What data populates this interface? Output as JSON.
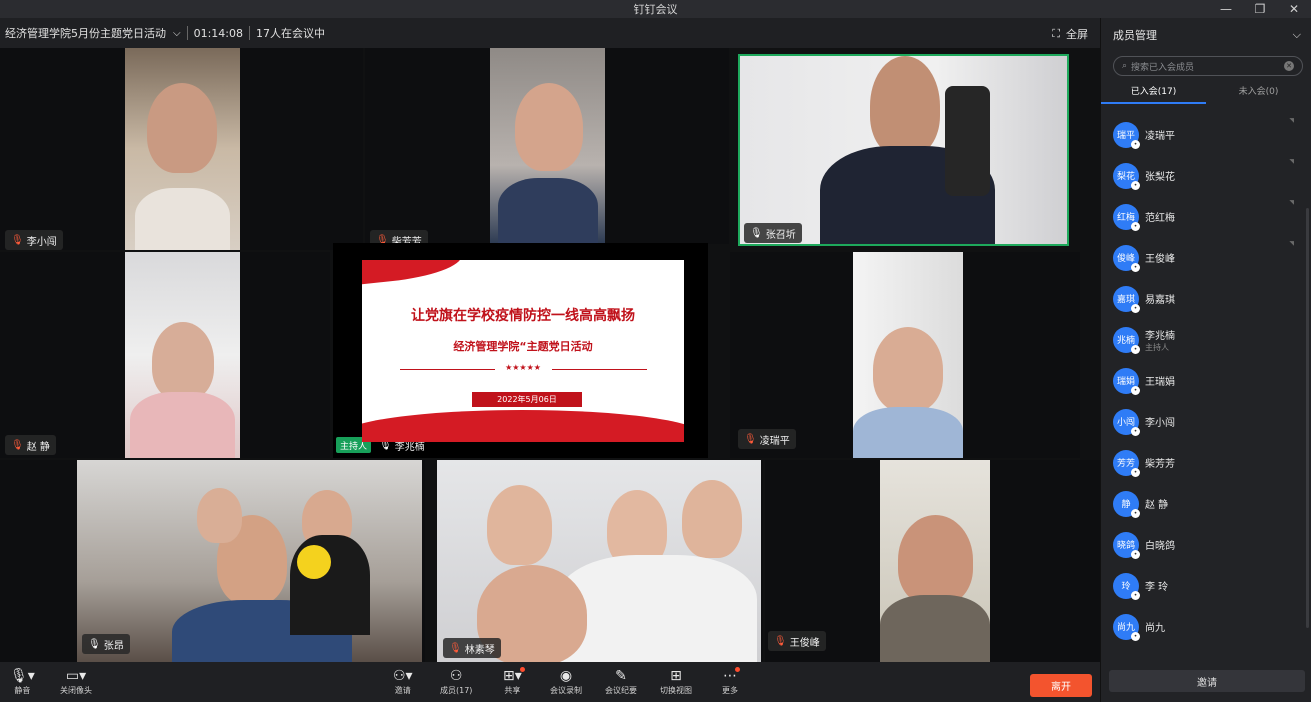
{
  "window": {
    "title": "钉钉会议"
  },
  "infobar": {
    "meeting_name": "经济管理学院5月份主题党日活动",
    "duration": "01:14:08",
    "count_text": "17人在会议中",
    "fullscreen_label": "全屏"
  },
  "tiles": [
    {
      "name": "李小闯"
    },
    {
      "name": "柴芳芳"
    },
    {
      "name": "张召圻"
    },
    {
      "name": "赵 静"
    },
    {
      "name": "李兆楠",
      "badge": "主持人"
    },
    {
      "name": "凌瑞平"
    },
    {
      "name": "张昂"
    },
    {
      "name": "林素琴"
    },
    {
      "name": "王俊峰"
    }
  ],
  "slide": {
    "title": "让党旗在学校疫情防控一线高高飘扬",
    "subtitle": "经济管理学院“主题党日活动",
    "stars": "★★★★★",
    "date": "2022年5月06日"
  },
  "sidebar": {
    "title": "成员管理",
    "search_placeholder": "搜索已入会成员",
    "tab_joined": "已入会(17)",
    "tab_not_joined": "未入会(0)",
    "members": [
      {
        "avatar": "瑞平",
        "name": "凌瑞平"
      },
      {
        "avatar": "梨花",
        "name": "张梨花"
      },
      {
        "avatar": "红梅",
        "name": "范红梅"
      },
      {
        "avatar": "俊峰",
        "name": "王俊峰"
      },
      {
        "avatar": "嘉琪",
        "name": "易嘉琪"
      },
      {
        "avatar": "兆楠",
        "name": "李兆楠",
        "sub": "主持人"
      },
      {
        "avatar": "瑞娟",
        "name": "王瑞娟"
      },
      {
        "avatar": "小闯",
        "name": "李小闯"
      },
      {
        "avatar": "芳芳",
        "name": "柴芳芳"
      },
      {
        "avatar": "静",
        "name": "赵 静"
      },
      {
        "avatar": "晓鸽",
        "name": "白晓鸽"
      },
      {
        "avatar": "玲",
        "name": "李 玲"
      },
      {
        "avatar": "尚九",
        "name": "尚九"
      }
    ],
    "invite_label": "邀请"
  },
  "toolbar": {
    "mute": "静音",
    "camera_off": "关闭像头",
    "invite": "邀请",
    "members": "成员(17)",
    "share": "共享",
    "record": "会议录制",
    "minutes": "会议纪要",
    "switch_view": "切换视图",
    "more": "更多",
    "leave": "离开"
  },
  "colors": {
    "accent": "#2f7cf6",
    "leave": "#f3542e",
    "host_badge": "#18a05a",
    "slide_red": "#c0121b"
  }
}
